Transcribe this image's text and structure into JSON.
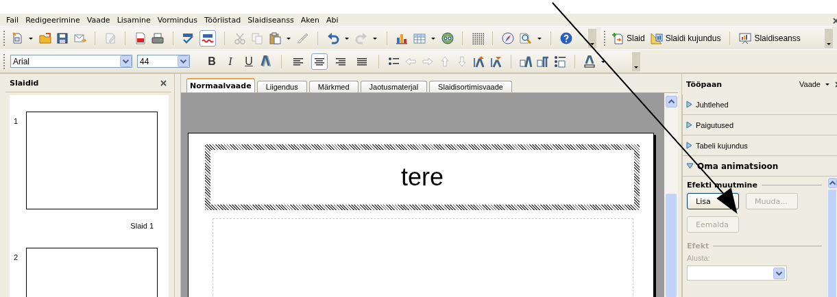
{
  "menu": [
    "Fail",
    "Redigeerimine",
    "Vaade",
    "Lisamine",
    "Vormindus",
    "Tööriistad",
    "Slaidiseanss",
    "Aken",
    "Abi"
  ],
  "presentation_toolbar": [
    {
      "label": "Slaid",
      "kind": "new-slide"
    },
    {
      "label": "Slaidi kujundus",
      "kind": "design"
    },
    {
      "label": "Slaidiseanss",
      "kind": "show"
    }
  ],
  "font_name": {
    "value": "Arial"
  },
  "font_size": {
    "value": "44"
  },
  "text_style_buttons": [
    {
      "label": "B",
      "kind": "bold"
    },
    {
      "label": "I",
      "kind": "italic"
    },
    {
      "label": "U",
      "kind": "underline"
    }
  ],
  "alignment": [
    {
      "kind": "left",
      "selected": false
    },
    {
      "kind": "center",
      "selected": true
    },
    {
      "kind": "right",
      "selected": false
    },
    {
      "kind": "justify",
      "selected": false
    }
  ],
  "slides_panel": {
    "title": "Slaidid",
    "slides": [
      {
        "number": "1",
        "label": "Slaid 1"
      },
      {
        "number": "2"
      }
    ]
  },
  "view_tabs": [
    {
      "label": "Normaalvaade",
      "selected": true
    },
    {
      "label": "Liigendus",
      "selected": false
    },
    {
      "label": "Märkmed",
      "selected": false
    },
    {
      "label": "Jaotusmaterjal",
      "selected": false
    },
    {
      "label": "Slaidisortimisvaade",
      "selected": false
    }
  ],
  "slide": {
    "title": "tere"
  },
  "task_pane": {
    "title": "Tööpaan",
    "view_menu": "Vaade",
    "sections": [
      {
        "label": "Juhtlehed",
        "expanded": false
      },
      {
        "label": "Paigutused",
        "expanded": false
      },
      {
        "label": "Tabeli kujundus",
        "expanded": false
      },
      {
        "label": "Oma animatsioon",
        "expanded": true
      }
    ],
    "modify_heading": "Efekti muutmine",
    "buttons": [
      {
        "label": "Lisa",
        "disabled": false
      },
      {
        "label": "Muuda...",
        "disabled": true
      },
      {
        "label": "Eemalda",
        "disabled": true
      }
    ],
    "effect": {
      "heading": "Efekt",
      "start_label": "Alusta:",
      "disabled": true
    }
  }
}
